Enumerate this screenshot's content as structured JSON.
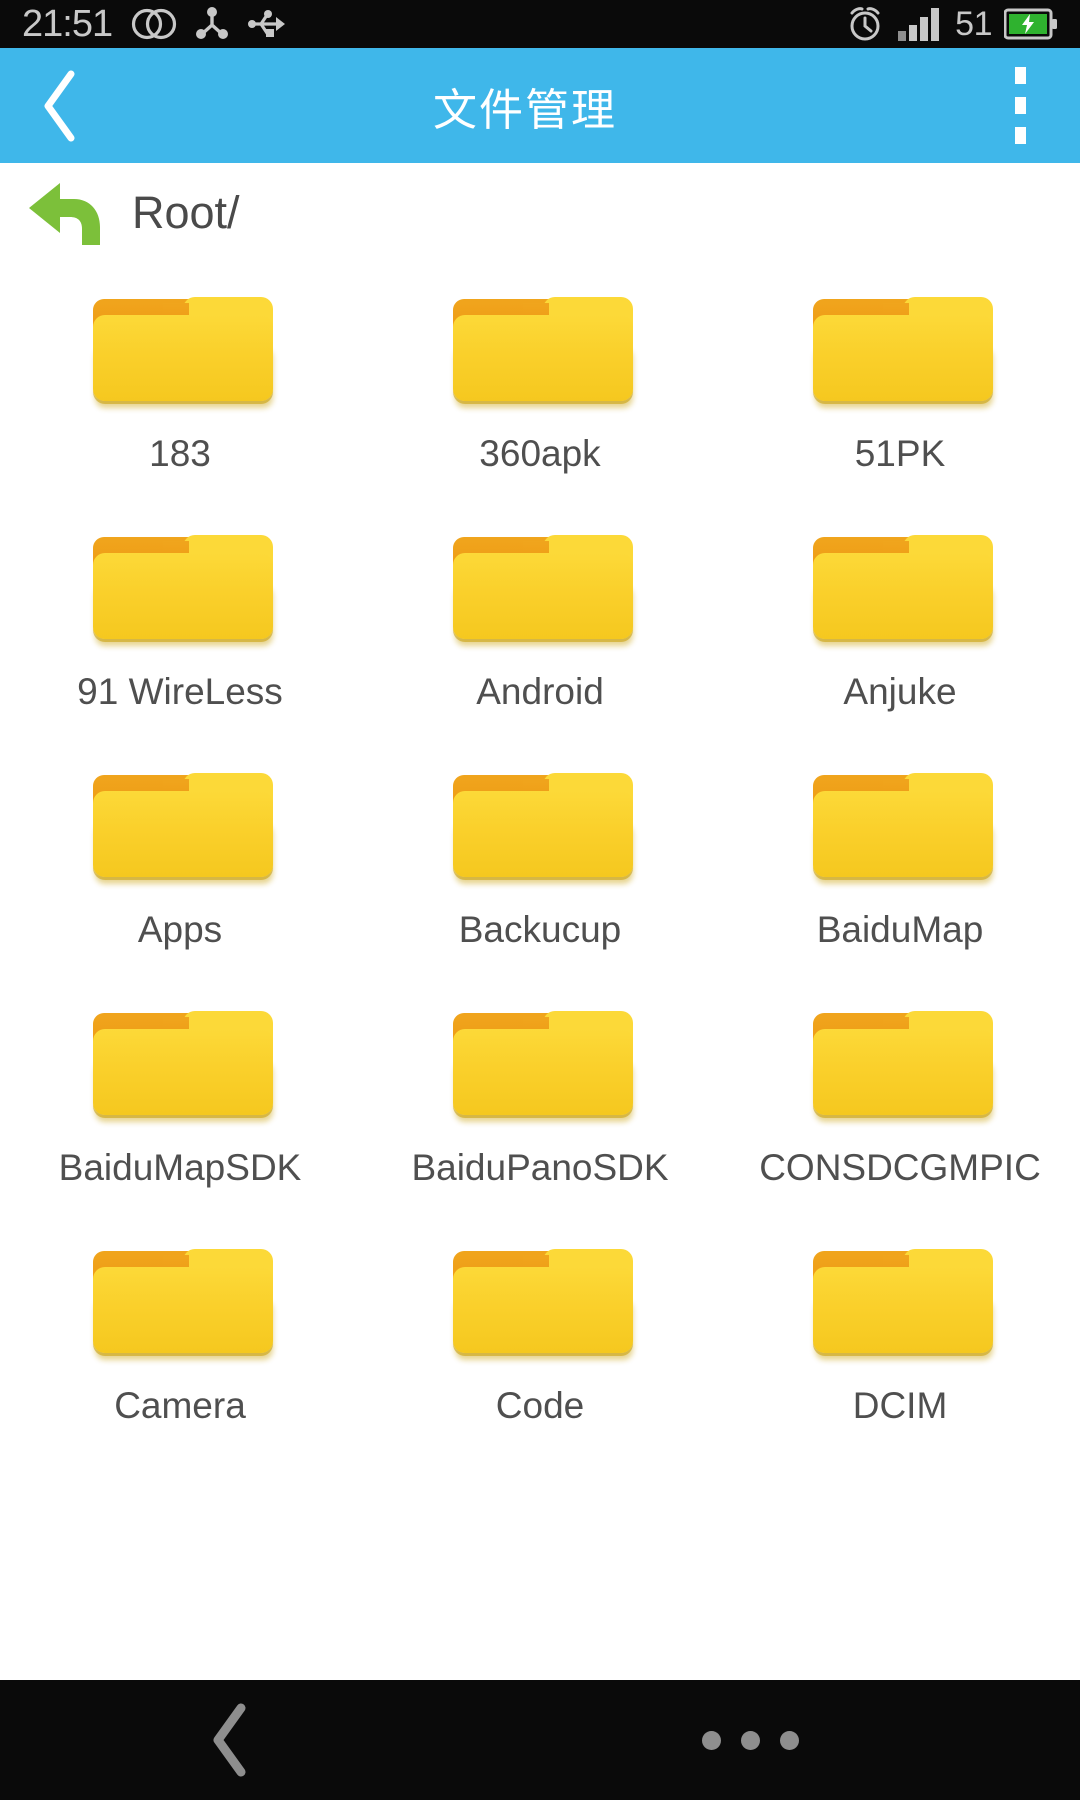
{
  "statusbar": {
    "time": "21:51",
    "battery_percent": "51",
    "icons": {
      "dual_sim": "dual-sim-icon",
      "share": "share-node-icon",
      "usb": "usb-icon",
      "alarm": "alarm-clock-icon",
      "signal": "signal-bars-icon",
      "battery": "battery-charging-icon"
    },
    "signal_bars": 4,
    "background": "#0a0a0a",
    "foreground": "#c8c8c8",
    "battery_fill": "#2fb22f"
  },
  "appbar": {
    "title": "文件管理",
    "back_label": "返回",
    "menu_label": "更多",
    "background": "#3fb7ea",
    "foreground": "#ffffff"
  },
  "pathbar": {
    "up_label": "上一级",
    "path": "Root/",
    "up_icon_color": "#7cc03a"
  },
  "grid": {
    "columns": 3,
    "items": [
      {
        "name": "183",
        "type": "folder"
      },
      {
        "name": "360apk",
        "type": "folder"
      },
      {
        "name": "51PK",
        "type": "folder"
      },
      {
        "name": "91 WireLess",
        "type": "folder"
      },
      {
        "name": "Android",
        "type": "folder"
      },
      {
        "name": "Anjuke",
        "type": "folder"
      },
      {
        "name": "Apps",
        "type": "folder"
      },
      {
        "name": "Backucup",
        "type": "folder"
      },
      {
        "name": "BaiduMap",
        "type": "folder"
      },
      {
        "name": "BaiduMapSDK",
        "type": "folder"
      },
      {
        "name": "BaiduPanoSDK",
        "type": "folder"
      },
      {
        "name": "CONSDCGMPIC",
        "type": "folder"
      },
      {
        "name": "Camera",
        "type": "folder"
      },
      {
        "name": "Code",
        "type": "folder"
      },
      {
        "name": "DCIM",
        "type": "folder"
      }
    ],
    "folder_color_front": "#fad02b",
    "folder_color_back": "#ee9b14",
    "label_color": "#4f4f4f"
  },
  "navbar": {
    "back_label": "返回",
    "recents_label": "最近任务",
    "background": "#0a0a0a",
    "foreground": "#8e8e8e"
  }
}
